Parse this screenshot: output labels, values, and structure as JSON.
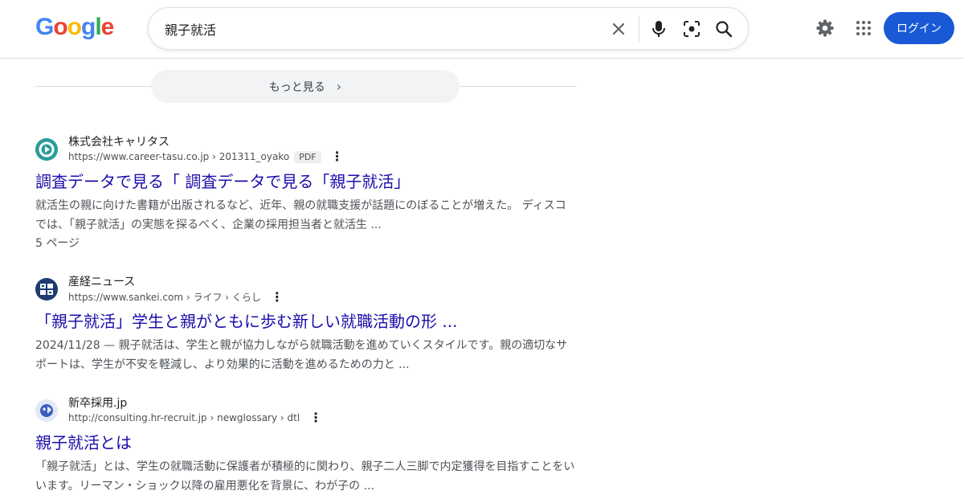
{
  "header": {
    "logo_letters": [
      "G",
      "o",
      "o",
      "g",
      "l",
      "e"
    ],
    "search": {
      "query": "親子就活"
    },
    "icons": [
      "clear-icon",
      "mic-icon",
      "lens-icon",
      "search-icon",
      "gear-icon",
      "apps-icon"
    ],
    "login_label": "ログイン"
  },
  "more": {
    "label": "もっと見る",
    "chevron": "›"
  },
  "results": [
    {
      "site_name": "株式会社キャリタス",
      "url": "https://www.career-tasu.co.jp › 201311_oyako",
      "badge": "PDF",
      "title": "調査データで見る「 調査データで見る「親子就活」",
      "snippet": "就活生の親に向けた書籍が出版されるなど、近年、親の就職支援が話題にのぼることが増えた。 ディスコでは、「親子就活」の実態を探るべく、企業の採用担当者と就活生 ...",
      "meta": "5 ページ"
    },
    {
      "site_name": "産経ニュース",
      "url": "https://www.sankei.com › ライフ › くらし",
      "title": "「親子就活」学生と親がともに歩む新しい就職活動の形 ...",
      "snippet": "2024/11/28 — 親子就活は、学生と親が協力しながら就職活動を進めていくスタイルです。親の適切なサポートは、学生が不安を軽減し、より効果的に活動を進めるための力と ..."
    },
    {
      "site_name": "新卒採用.jp",
      "url": "http://consulting.hr-recruit.jp › newglossary › dtl",
      "title": "親子就活とは",
      "snippet": "「親子就活」とは、学生の就職活動に保護者が積極的に関わり、親子二人三脚で内定獲得を目指すことをいいます。リーマン・ショック以降の雇用悪化を背景に、わが子の ..."
    }
  ],
  "colors": {
    "link": "#1a0dab",
    "accent": "#1a59d6"
  }
}
